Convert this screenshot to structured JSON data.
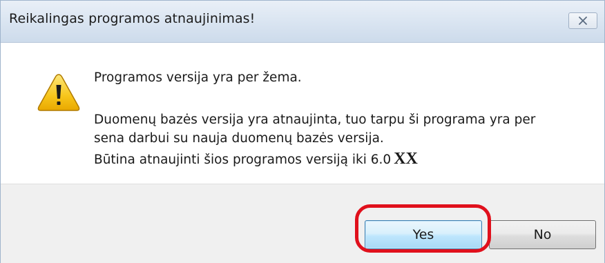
{
  "dialog": {
    "title": "Reikalingas programos atnaujinimas!",
    "close_symbol": "✕",
    "icon": "warning-icon",
    "message_version": "Programos versija yra per žema.",
    "message_line1": "Duomenų bazės versija yra atnaujinta, tuo tarpu ši programa yra per",
    "message_line2": "sena darbui su nauja duomenų bazės versija.",
    "message_line3": "Būtina atnaujinti šios programos versiją iki 6.0",
    "version_suffix": "XX"
  },
  "buttons": {
    "yes_label": "Yes",
    "no_label": "No"
  },
  "colors": {
    "highlight": "#e0101c",
    "warning_fill": "#f7c51b",
    "default_button_border": "#3c7fb1"
  }
}
